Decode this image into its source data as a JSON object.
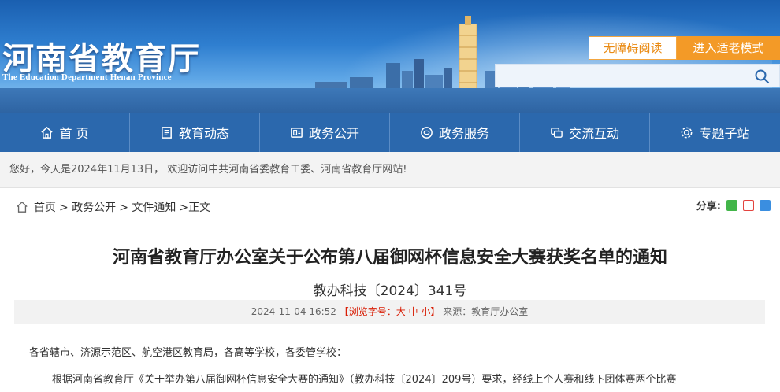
{
  "header": {
    "logo_cn": "河南省教育厅",
    "logo_en": "The Education Department Henan Province",
    "accessibility_label": "无障碍阅读",
    "elder_mode_label": "进入适老模式",
    "search_placeholder": ""
  },
  "nav": {
    "items": [
      {
        "label": "首 页",
        "icon": "home-icon"
      },
      {
        "label": "教育动态",
        "icon": "news-icon"
      },
      {
        "label": "政务公开",
        "icon": "document-icon"
      },
      {
        "label": "政务服务",
        "icon": "service-icon"
      },
      {
        "label": "交流互动",
        "icon": "chat-icon"
      },
      {
        "label": "专题子站",
        "icon": "gear-icon"
      }
    ]
  },
  "welcome": "您好，今天是2024年11月13日， 欢迎访问中共河南省委教育工委、河南省教育厅网站!",
  "breadcrumb": {
    "items": [
      "首页",
      "> 政务公开",
      "> 文件通知",
      ">正文"
    ]
  },
  "share": {
    "label": "分享:",
    "targets": [
      "wechat",
      "weibo",
      "qq"
    ]
  },
  "article": {
    "title": "河南省教育厅办公室关于公布第八届御网杯信息安全大赛获奖名单的通知",
    "doc_number": "教办科技〔2024〕341号",
    "date": "2024-11-04 16:52",
    "font_size_control": "【浏览字号：大 中 小】",
    "source": "来源：教育厅办公室",
    "recipients": "各省辖市、济源示范区、航空港区教育局，各高等学校，各委管学校：",
    "paragraph1": "根据河南省教育厅《关于举办第八届御网杯信息安全大赛的通知》（教办科技〔2024〕209号）要求，经线上个人赛和线下团体赛两个比赛"
  },
  "colors": {
    "nav_bg": "#2b68ad",
    "accent_orange": "#f39a27",
    "font_ctrl_red": "#d81e06"
  }
}
